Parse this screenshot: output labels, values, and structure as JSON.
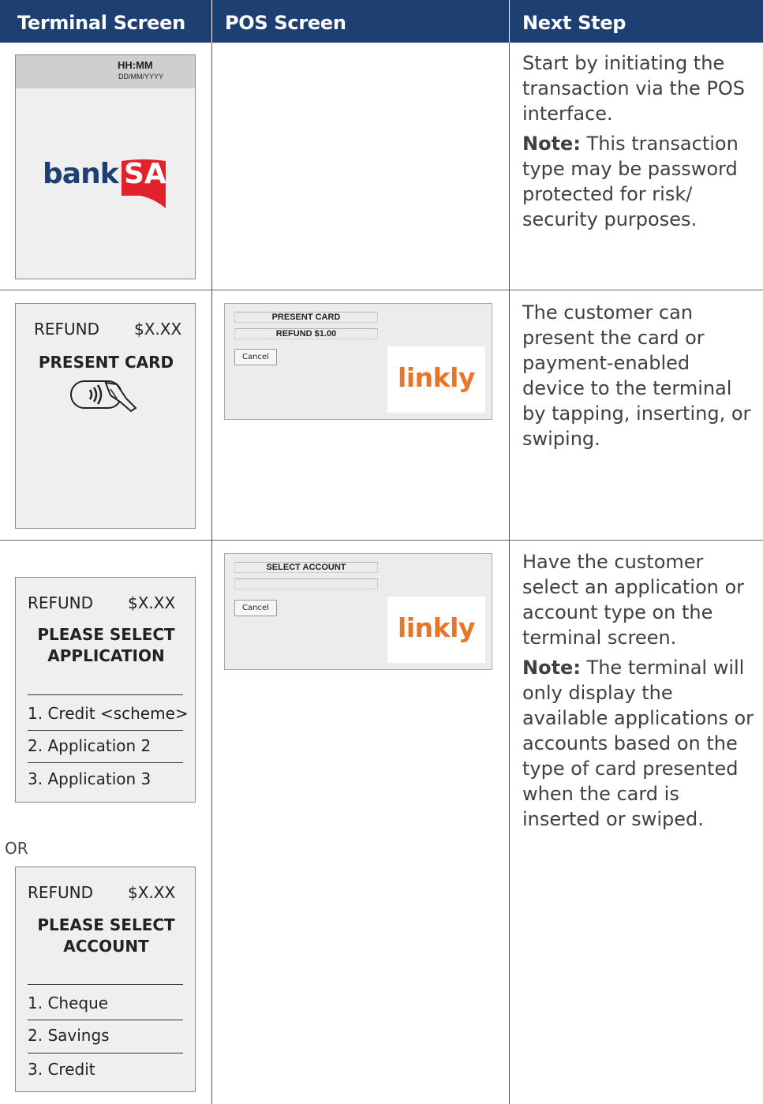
{
  "header": {
    "col1": "Terminal Screen",
    "col2": "POS Screen",
    "col3": "Next Step"
  },
  "colors": {
    "header_bg": "#1d3f72",
    "bank_blue": "#1d3f72",
    "bank_red": "#e0222a",
    "linkly_orange": "#e8762a"
  },
  "row1": {
    "terminal": {
      "time": "HH:MM",
      "date": "DD/MM/YYYY",
      "logo_left": "bank",
      "logo_right": "SA"
    },
    "step_p1": "Start by initiating the transaction via the POS interface.",
    "note_label": "Note:",
    "note_text": " This transaction type may be password protected for risk/ security purposes."
  },
  "row2": {
    "terminal": {
      "label": "REFUND",
      "amount": "$X.XX",
      "heading": "PRESENT CARD",
      "icon": "contactless-card-icon"
    },
    "pos": {
      "line1": "PRESENT CARD",
      "line2": "REFUND   $1.00",
      "cancel": "Cancel",
      "logo": "linkly"
    },
    "step_p1": "The customer can present the card or payment-enabled device to the terminal by tapping, inserting, or swiping."
  },
  "row3": {
    "terminal_app": {
      "label": "REFUND",
      "amount": "$X.XX",
      "heading1": "PLEASE SELECT",
      "heading2": "APPLICATION",
      "items": [
        "1. Credit <scheme>",
        "2. Application 2",
        "3. Application 3"
      ]
    },
    "or_label": "OR",
    "terminal_acc": {
      "label": "REFUND",
      "amount": "$X.XX",
      "heading1": "PLEASE SELECT",
      "heading2": "ACCOUNT",
      "items": [
        "1. Cheque",
        "2. Savings",
        "3. Credit"
      ]
    },
    "pos": {
      "line1": "SELECT ACCOUNT",
      "line2": "",
      "cancel": "Cancel",
      "logo": "linkly"
    },
    "step_p1": "Have the customer select an application or account type on the terminal screen.",
    "note_label": "Note:",
    "note_text": " The terminal will only display the available applications or accounts based on the type of card presented when the card is inserted or swiped."
  }
}
